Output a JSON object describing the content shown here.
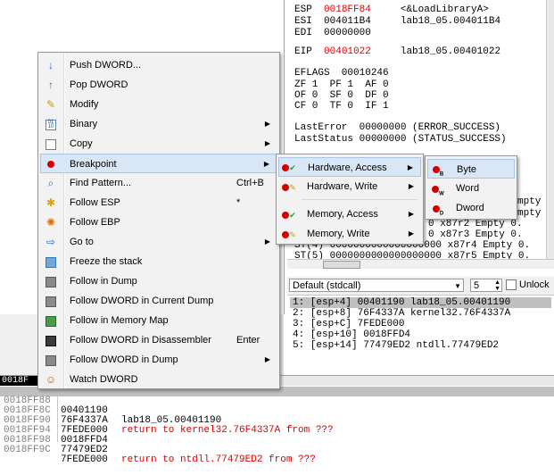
{
  "registers": {
    "lines": [
      {
        "name": "ESP",
        "value": "0018FF84",
        "comment": "<&LoadLibraryA>",
        "value_red": true
      },
      {
        "name": "ESI",
        "value": "004011B4",
        "comment": "lab18_05.004011B4",
        "value_red": false
      },
      {
        "name": "EDI",
        "value": "00000000",
        "comment": "",
        "value_red": false
      },
      {
        "name": "EIP",
        "value": "00401022",
        "comment": "lab18_05.00401022",
        "value_red": true
      }
    ],
    "eflags": "EFLAGS  00010246",
    "flags_rows": [
      "ZF 1  PF 1  AF 0",
      "OF 0  SF 0  DF 0",
      "CF 0  TF 0  IF 1"
    ],
    "last_error": "LastError  00000000 (ERROR_SUCCESS)",
    "last_status": "LastStatus 00000000 (STATUS_SUCCESS)",
    "fpu_rows": [
      "mpty 0.",
      "mpty 0.",
      "0 x87r2 Empty 0.",
      "0 x87r3 Empty 0.",
      "ST(4) 0000000000000000000 x87r4 Empty 0.",
      "ST(5) 0000000000000000000 x87r5 Empty 0."
    ]
  },
  "callconv": {
    "selected": "Default (stdcall)",
    "arg_count": "5",
    "unlock_label": "Unlock"
  },
  "args": [
    "1: [esp+4] 00401190 lab18_05.00401190",
    "2: [esp+8] 76F4337A kernel32.76F4337A",
    "3: [esp+C] 7FEDE000",
    "4: [esp+10] 0018FFD4",
    "5: [esp+14] 77479ED2 ntdll.77479ED2"
  ],
  "stack": {
    "header_addr": "0018F",
    "rows": [
      {
        "addr": "0018FF88",
        "val": "00401190",
        "cmt": "lab18_05.00401190",
        "cmt_red": false,
        "selected": true
      },
      {
        "addr": "0018FF8C",
        "val": "76F4337A",
        "cmt": "return to kernel32.76F4337A from ???",
        "cmt_red": true,
        "selected": false
      },
      {
        "addr": "0018FF90",
        "val": "7FEDE000",
        "cmt": "",
        "cmt_red": false,
        "selected": false
      },
      {
        "addr": "0018FF94",
        "val": "0018FFD4",
        "cmt": "",
        "cmt_red": false,
        "selected": false
      },
      {
        "addr": "0018FF98",
        "val": "77479ED2",
        "cmt": "return to ntdll.77479ED2 from ???",
        "cmt_red": true,
        "selected": false
      },
      {
        "addr": "0018FF9C",
        "val": "7FEDE000",
        "cmt": "",
        "cmt_red": false,
        "selected": false
      }
    ]
  },
  "context_menu": {
    "items": [
      {
        "label": "Push DWORD...",
        "icon": "arrow-down-icon",
        "shortcut": "",
        "submenu": false
      },
      {
        "label": "Pop DWORD",
        "icon": "arrow-up-icon",
        "shortcut": "",
        "submenu": false
      },
      {
        "label": "Modify",
        "icon": "pencil-icon",
        "shortcut": "",
        "submenu": false
      },
      {
        "label": "Binary",
        "icon": "binary-icon",
        "shortcut": "",
        "submenu": true
      },
      {
        "label": "Copy",
        "icon": "copy-icon",
        "shortcut": "",
        "submenu": true
      },
      {
        "label": "Breakpoint",
        "icon": "breakpoint-icon",
        "shortcut": "",
        "submenu": true
      },
      {
        "label": "Find Pattern...",
        "icon": "find-icon",
        "shortcut": "Ctrl+B",
        "submenu": false
      },
      {
        "label": "Follow ESP",
        "icon": "star-icon",
        "shortcut": "*",
        "submenu": false
      },
      {
        "label": "Follow EBP",
        "icon": "gear-icon",
        "shortcut": "",
        "submenu": false
      },
      {
        "label": "Go to",
        "icon": "goto-icon",
        "shortcut": "",
        "submenu": true
      },
      {
        "label": "Freeze the stack",
        "icon": "freeze-icon",
        "shortcut": "",
        "submenu": false
      },
      {
        "label": "Follow in Dump",
        "icon": "dump-icon",
        "shortcut": "",
        "submenu": false
      },
      {
        "label": "Follow DWORD in Current Dump",
        "icon": "dump-icon",
        "shortcut": "",
        "submenu": false
      },
      {
        "label": "Follow in Memory Map",
        "icon": "memory-map-icon",
        "shortcut": "",
        "submenu": false
      },
      {
        "label": "Follow DWORD in Disassembler",
        "icon": "disassembler-icon",
        "shortcut": "Enter",
        "submenu": false
      },
      {
        "label": "Follow DWORD in Dump",
        "icon": "dump-icon",
        "shortcut": "",
        "submenu": true
      },
      {
        "label": "Watch DWORD",
        "icon": "watch-icon",
        "shortcut": "",
        "submenu": false
      }
    ]
  },
  "breakpoint_submenu": {
    "items": [
      "Hardware, Access",
      "Hardware, Write",
      "Memory, Access",
      "Memory, Write"
    ]
  },
  "hardware_submenu": {
    "items": [
      {
        "label": "Byte",
        "badge": "B"
      },
      {
        "label": "Word",
        "badge": "W"
      },
      {
        "label": "Dword",
        "badge": "D"
      }
    ]
  },
  "colors": {
    "highlight": "#d9e6f5",
    "accent_red": "#e00000",
    "menu_bg": "#f2f2f2"
  }
}
